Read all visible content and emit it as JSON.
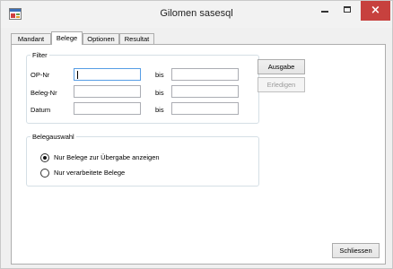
{
  "window": {
    "title": "Gilomen sasesql",
    "close_glyph": "×"
  },
  "tabs": [
    {
      "label": "Mandant"
    },
    {
      "label": "Belege"
    },
    {
      "label": "Optionen"
    },
    {
      "label": "Resultat"
    }
  ],
  "active_tab": "Belege",
  "filter": {
    "legend": "Filter",
    "rows": [
      {
        "label": "OP-Nr",
        "from_value": "",
        "bis_label": "bis",
        "to_value": ""
      },
      {
        "label": "Beleg-Nr",
        "from_value": "",
        "bis_label": "bis",
        "to_value": ""
      },
      {
        "label": "Datum",
        "from_value": "",
        "bis_label": "bis",
        "to_value": ""
      }
    ]
  },
  "actions": {
    "ausgabe_label": "Ausgabe",
    "erledigen_label": "Erledigen",
    "schliessen_label": "Schliessen"
  },
  "belegauswahl": {
    "legend": "Belegauswahl",
    "options": [
      {
        "label": "Nur Belege zur Übergabe anzeigen",
        "selected": true
      },
      {
        "label": "Nur verarbeitete Belege",
        "selected": false
      }
    ]
  },
  "icons": {
    "app": "app-window-icon",
    "minimize": "minimize-icon",
    "maximize": "maximize-icon",
    "close": "close-icon"
  },
  "colors": {
    "close_button": "#c7413e",
    "focus_border": "#569de5"
  }
}
